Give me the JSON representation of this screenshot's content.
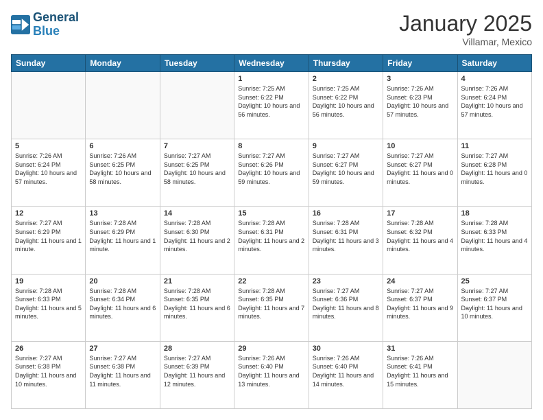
{
  "header": {
    "logo_line1": "General",
    "logo_line2": "Blue",
    "month": "January 2025",
    "location": "Villamar, Mexico"
  },
  "weekdays": [
    "Sunday",
    "Monday",
    "Tuesday",
    "Wednesday",
    "Thursday",
    "Friday",
    "Saturday"
  ],
  "weeks": [
    [
      {
        "day": "",
        "info": ""
      },
      {
        "day": "",
        "info": ""
      },
      {
        "day": "",
        "info": ""
      },
      {
        "day": "1",
        "info": "Sunrise: 7:25 AM\nSunset: 6:22 PM\nDaylight: 10 hours\nand 56 minutes."
      },
      {
        "day": "2",
        "info": "Sunrise: 7:25 AM\nSunset: 6:22 PM\nDaylight: 10 hours\nand 56 minutes."
      },
      {
        "day": "3",
        "info": "Sunrise: 7:26 AM\nSunset: 6:23 PM\nDaylight: 10 hours\nand 57 minutes."
      },
      {
        "day": "4",
        "info": "Sunrise: 7:26 AM\nSunset: 6:24 PM\nDaylight: 10 hours\nand 57 minutes."
      }
    ],
    [
      {
        "day": "5",
        "info": "Sunrise: 7:26 AM\nSunset: 6:24 PM\nDaylight: 10 hours\nand 57 minutes."
      },
      {
        "day": "6",
        "info": "Sunrise: 7:26 AM\nSunset: 6:25 PM\nDaylight: 10 hours\nand 58 minutes."
      },
      {
        "day": "7",
        "info": "Sunrise: 7:27 AM\nSunset: 6:25 PM\nDaylight: 10 hours\nand 58 minutes."
      },
      {
        "day": "8",
        "info": "Sunrise: 7:27 AM\nSunset: 6:26 PM\nDaylight: 10 hours\nand 59 minutes."
      },
      {
        "day": "9",
        "info": "Sunrise: 7:27 AM\nSunset: 6:27 PM\nDaylight: 10 hours\nand 59 minutes."
      },
      {
        "day": "10",
        "info": "Sunrise: 7:27 AM\nSunset: 6:27 PM\nDaylight: 11 hours\nand 0 minutes."
      },
      {
        "day": "11",
        "info": "Sunrise: 7:27 AM\nSunset: 6:28 PM\nDaylight: 11 hours\nand 0 minutes."
      }
    ],
    [
      {
        "day": "12",
        "info": "Sunrise: 7:27 AM\nSunset: 6:29 PM\nDaylight: 11 hours\nand 1 minute."
      },
      {
        "day": "13",
        "info": "Sunrise: 7:28 AM\nSunset: 6:29 PM\nDaylight: 11 hours\nand 1 minute."
      },
      {
        "day": "14",
        "info": "Sunrise: 7:28 AM\nSunset: 6:30 PM\nDaylight: 11 hours\nand 2 minutes."
      },
      {
        "day": "15",
        "info": "Sunrise: 7:28 AM\nSunset: 6:31 PM\nDaylight: 11 hours\nand 2 minutes."
      },
      {
        "day": "16",
        "info": "Sunrise: 7:28 AM\nSunset: 6:31 PM\nDaylight: 11 hours\nand 3 minutes."
      },
      {
        "day": "17",
        "info": "Sunrise: 7:28 AM\nSunset: 6:32 PM\nDaylight: 11 hours\nand 4 minutes."
      },
      {
        "day": "18",
        "info": "Sunrise: 7:28 AM\nSunset: 6:33 PM\nDaylight: 11 hours\nand 4 minutes."
      }
    ],
    [
      {
        "day": "19",
        "info": "Sunrise: 7:28 AM\nSunset: 6:33 PM\nDaylight: 11 hours\nand 5 minutes."
      },
      {
        "day": "20",
        "info": "Sunrise: 7:28 AM\nSunset: 6:34 PM\nDaylight: 11 hours\nand 6 minutes."
      },
      {
        "day": "21",
        "info": "Sunrise: 7:28 AM\nSunset: 6:35 PM\nDaylight: 11 hours\nand 6 minutes."
      },
      {
        "day": "22",
        "info": "Sunrise: 7:28 AM\nSunset: 6:35 PM\nDaylight: 11 hours\nand 7 minutes."
      },
      {
        "day": "23",
        "info": "Sunrise: 7:27 AM\nSunset: 6:36 PM\nDaylight: 11 hours\nand 8 minutes."
      },
      {
        "day": "24",
        "info": "Sunrise: 7:27 AM\nSunset: 6:37 PM\nDaylight: 11 hours\nand 9 minutes."
      },
      {
        "day": "25",
        "info": "Sunrise: 7:27 AM\nSunset: 6:37 PM\nDaylight: 11 hours\nand 10 minutes."
      }
    ],
    [
      {
        "day": "26",
        "info": "Sunrise: 7:27 AM\nSunset: 6:38 PM\nDaylight: 11 hours\nand 10 minutes."
      },
      {
        "day": "27",
        "info": "Sunrise: 7:27 AM\nSunset: 6:38 PM\nDaylight: 11 hours\nand 11 minutes."
      },
      {
        "day": "28",
        "info": "Sunrise: 7:27 AM\nSunset: 6:39 PM\nDaylight: 11 hours\nand 12 minutes."
      },
      {
        "day": "29",
        "info": "Sunrise: 7:26 AM\nSunset: 6:40 PM\nDaylight: 11 hours\nand 13 minutes."
      },
      {
        "day": "30",
        "info": "Sunrise: 7:26 AM\nSunset: 6:40 PM\nDaylight: 11 hours\nand 14 minutes."
      },
      {
        "day": "31",
        "info": "Sunrise: 7:26 AM\nSunset: 6:41 PM\nDaylight: 11 hours\nand 15 minutes."
      },
      {
        "day": "",
        "info": ""
      }
    ]
  ]
}
